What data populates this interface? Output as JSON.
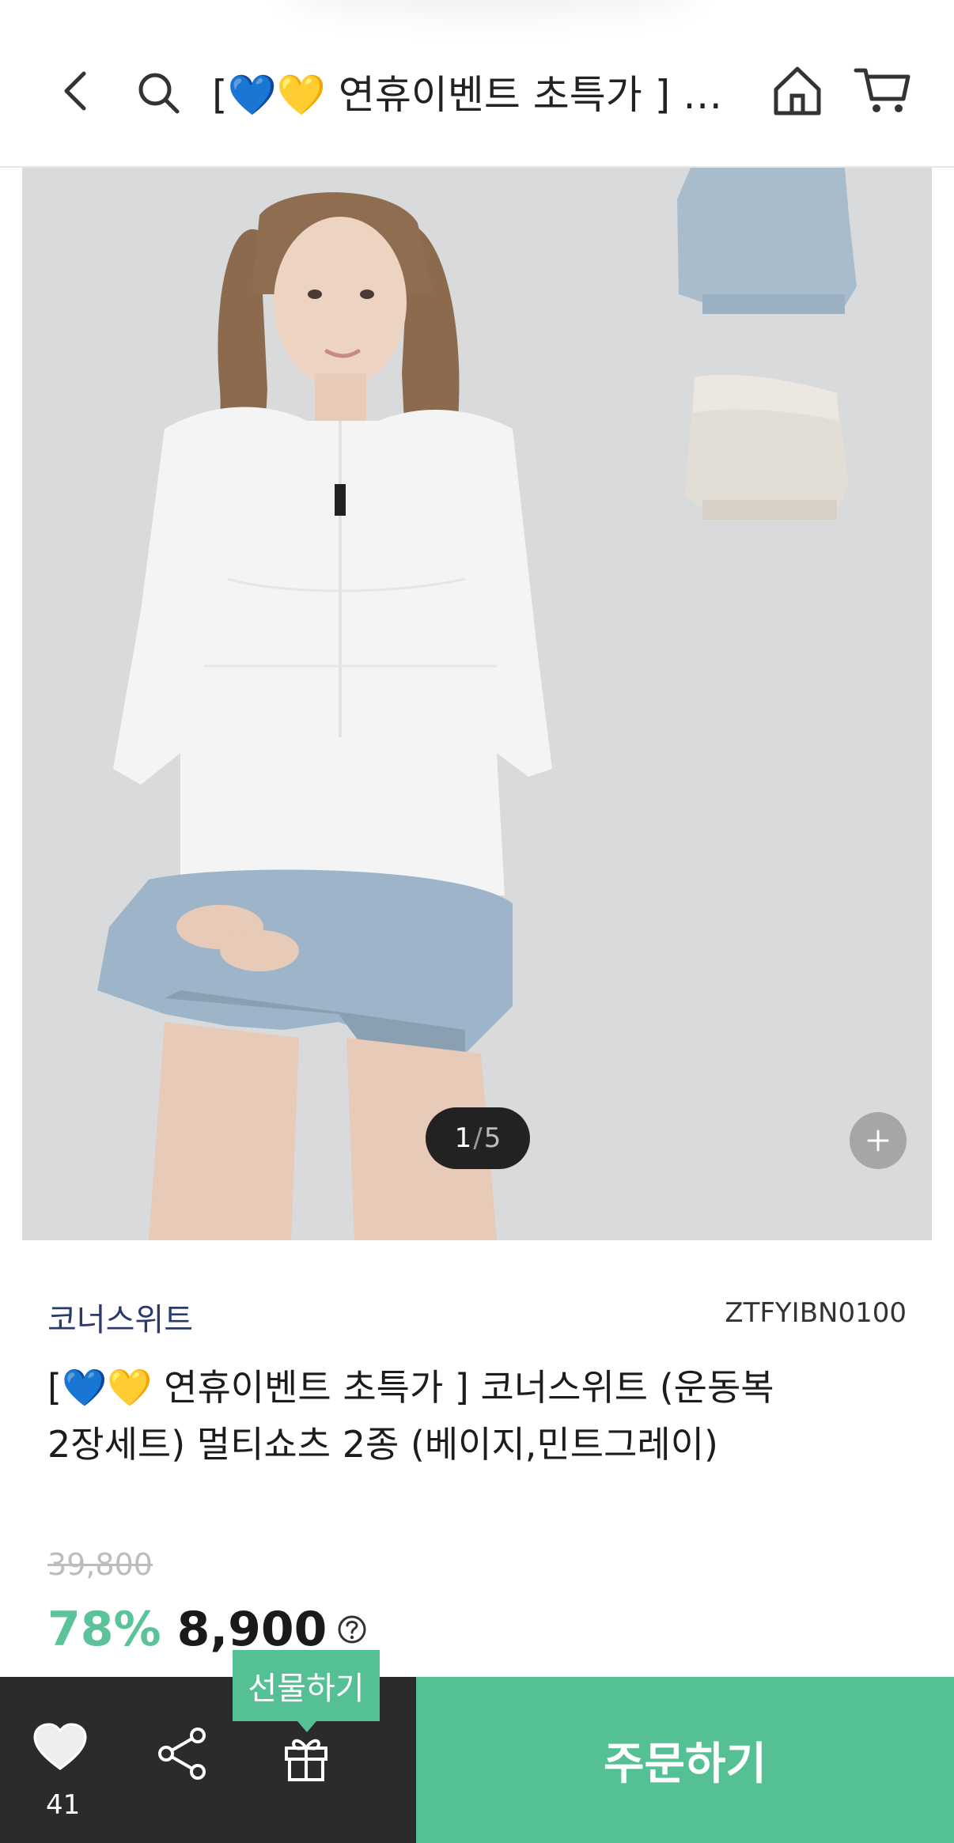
{
  "header": {
    "title": "[💙💛 연휴이벤트 초특가 ] 코너스위트 (운동복 2장세트) 멀티쇼츠 2종 (베이지,민트그레이)"
  },
  "gallery": {
    "current": "1",
    "separator": "/",
    "total": "5"
  },
  "product": {
    "brand": "코너스위트",
    "sku": "ZTFYIBN0100",
    "title_line1": "[💙💛 연휴이벤트 초특가 ] 코너스위트 (운동복",
    "title_line2": "2장세트) 멀티쇼츠 2종 (베이지,민트그레이)",
    "original_price": "39,800",
    "discount": "78%",
    "sale_price": "8,900"
  },
  "bottom_bar": {
    "like_count": "41",
    "gift_tooltip": "선물하기",
    "order_label": "주문하기"
  },
  "colors": {
    "accent": "#56c095",
    "dark_bar": "#2b2b2b",
    "discount_text": "#5cc29a",
    "brand_text": "#2a3a6a"
  },
  "icons": [
    "back-arrow-icon",
    "search-icon",
    "home-icon",
    "cart-icon",
    "plus-icon",
    "help-icon",
    "heart-icon",
    "share-icon",
    "gift-icon"
  ]
}
